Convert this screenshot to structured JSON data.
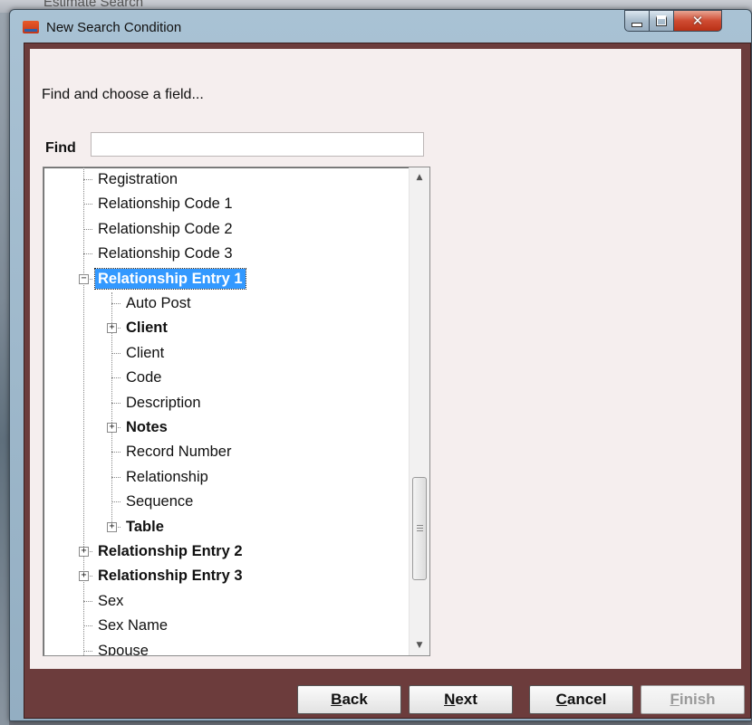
{
  "background": {
    "title": "Estimate Search"
  },
  "window": {
    "title": "New Search Condition",
    "controls": {
      "minimize": "minimize",
      "maximize": "maximize",
      "close": "close"
    }
  },
  "dialog": {
    "prompt": "Find and choose a field...",
    "find_label": "Find",
    "find_value": ""
  },
  "tree": {
    "items": [
      {
        "label": "Registration",
        "level": 1,
        "expander": null,
        "bold": false,
        "selected": false
      },
      {
        "label": "Relationship Code 1",
        "level": 1,
        "expander": null,
        "bold": false,
        "selected": false
      },
      {
        "label": "Relationship Code 2",
        "level": 1,
        "expander": null,
        "bold": false,
        "selected": false
      },
      {
        "label": "Relationship Code 3",
        "level": 1,
        "expander": null,
        "bold": false,
        "selected": false
      },
      {
        "label": "Relationship Entry 1",
        "level": 1,
        "expander": "minus",
        "bold": true,
        "selected": true
      },
      {
        "label": "Auto Post",
        "level": 2,
        "expander": null,
        "bold": false,
        "selected": false
      },
      {
        "label": "Client",
        "level": 2,
        "expander": "plus",
        "bold": true,
        "selected": false
      },
      {
        "label": "Client",
        "level": 2,
        "expander": null,
        "bold": false,
        "selected": false
      },
      {
        "label": "Code",
        "level": 2,
        "expander": null,
        "bold": false,
        "selected": false
      },
      {
        "label": "Description",
        "level": 2,
        "expander": null,
        "bold": false,
        "selected": false
      },
      {
        "label": "Notes",
        "level": 2,
        "expander": "plus",
        "bold": true,
        "selected": false
      },
      {
        "label": "Record Number",
        "level": 2,
        "expander": null,
        "bold": false,
        "selected": false
      },
      {
        "label": "Relationship",
        "level": 2,
        "expander": null,
        "bold": false,
        "selected": false
      },
      {
        "label": "Sequence",
        "level": 2,
        "expander": null,
        "bold": false,
        "selected": false
      },
      {
        "label": "Table",
        "level": 2,
        "expander": "plus",
        "bold": true,
        "selected": false
      },
      {
        "label": "Relationship Entry 2",
        "level": 1,
        "expander": "plus",
        "bold": true,
        "selected": false
      },
      {
        "label": "Relationship Entry 3",
        "level": 1,
        "expander": "plus",
        "bold": true,
        "selected": false
      },
      {
        "label": "Sex",
        "level": 1,
        "expander": null,
        "bold": false,
        "selected": false
      },
      {
        "label": "Sex Name",
        "level": 1,
        "expander": null,
        "bold": false,
        "selected": false
      },
      {
        "label": "Spouse",
        "level": 1,
        "expander": null,
        "bold": false,
        "selected": false
      }
    ]
  },
  "buttons": {
    "back": {
      "label": "Back",
      "accel": "B",
      "rest": "ack"
    },
    "next": {
      "label": "Next",
      "accel": "N",
      "rest": "ext"
    },
    "cancel": {
      "label": "Cancel",
      "accel": "C",
      "rest": "ancel"
    },
    "finish": {
      "label": "Finish",
      "accel": "F",
      "rest": "inish",
      "disabled": true
    }
  },
  "colors": {
    "selection": "#3399ff",
    "frame": "#6c3c3c",
    "panel": "#f5eeee"
  }
}
